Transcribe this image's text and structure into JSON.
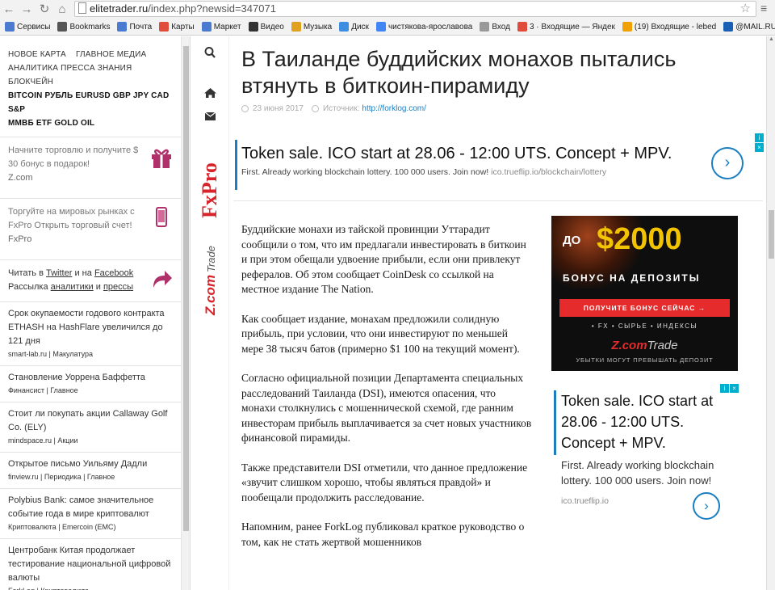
{
  "browser": {
    "url_host": "elitetrader.ru",
    "url_path": "/index.php?newsid=347071",
    "bookmarks": [
      {
        "label": "Сервисы",
        "color": "#4a7bd0"
      },
      {
        "label": "Bookmarks",
        "color": "#555555"
      },
      {
        "label": "Почта",
        "color": "#4a7bd0"
      },
      {
        "label": "Карты",
        "color": "#e14b3b"
      },
      {
        "label": "Маркет",
        "color": "#4a7bd0"
      },
      {
        "label": "Видео",
        "color": "#333333"
      },
      {
        "label": "Музыка",
        "color": "#e0a020"
      },
      {
        "label": "Диск",
        "color": "#3b8ee0"
      },
      {
        "label": "чистякова-ярославова",
        "color": "#4285f4"
      },
      {
        "label": "Вход",
        "color": "#999999"
      },
      {
        "label": "3 · Входящие — Яндек",
        "color": "#e14b3b"
      },
      {
        "label": "(19) Входящие - lebed",
        "color": "#f0a000"
      },
      {
        "label": "@MAIL.RU: почта, пои",
        "color": "#1a5fb4"
      }
    ]
  },
  "sidebar": {
    "categories_line1": [
      "НОВОЕ КАРТА",
      "ГЛАВНОЕ МЕДИА"
    ],
    "categories_line2": [
      "АНАЛИТИКА ПРЕССА ЗНАНИЯ БЛОКЧЕЙН"
    ],
    "categories_line3": [
      "BITCOIN РУБЛЬ EURUSD GBP JPY CAD S&P"
    ],
    "categories_line4": [
      "ММВБ ETF GOLD OIL"
    ],
    "promo1": {
      "text": "Начните торговлю и получите $ 30 бонус в подарок!",
      "source": "Z.com"
    },
    "promo2": {
      "text": "Торгуйте на мировых рынках с FxPro Открыть торговый счет!",
      "source": "FxPro"
    },
    "promo3": {
      "read_in": "Читать в",
      "twitter": "Twitter",
      "and": "и на",
      "facebook": "Facebook",
      "mailing": "Рассылка",
      "analytics": "аналитики",
      "and2": "и",
      "press": "прессы"
    },
    "news": [
      {
        "title": "Срок окупаемости годового контракта ETHASH на HashFlare увеличился до 121 дня",
        "source": "smart-lab.ru | Макулатура"
      },
      {
        "title": "Становление Уоррена Баффетта",
        "source": "Финансист | Главное"
      },
      {
        "title": "Стоит ли покупать акции Callaway Golf Co. (ELY)",
        "source": "mindspace.ru | Акции"
      },
      {
        "title": "Открытое письмо Уильяму Дадли",
        "source": "finview.ru | Периодика | Главное"
      },
      {
        "title": "Polybius Bank: самое значительное событие года в мире криптовалют",
        "source": "Криптовалюта | Emercoin (EMC)"
      },
      {
        "title": "Центробанк Китая продолжает тестирование национальной цифровой валюты",
        "source": "ForkLog | Криптовалюта"
      }
    ]
  },
  "brand_banners": {
    "fxpro": "FxPro",
    "zcom": "Z.com",
    "zcom_trade": "Trade"
  },
  "article": {
    "title": "В Таиланде буддийских монахов пытались втянуть в биткоин-пирамиду",
    "date": "23 июня 2017",
    "source_label": "Источник:",
    "source_url": "http://forklog.com/",
    "paragraphs": [
      "Буддийские монахи из тайской провинции Уттарадит сообщили о том, что им предлагали инвестировать в биткоин и при этом обещали удвоение прибыли, если они привлекут рефералов. Об этом сообщает CoinDesk со ссылкой на местное издание The Nation.",
      "Как сообщает издание, монахам предложили солидную прибыль, при условии, что они инвестируют по меньшей мере 38 тысяч батов (примерно $1 100 на текущий момент).",
      "Согласно официальной позиции Департамента специальных расследований Таиланда (DSI), имеются опасения, что монахи столкнулись с мошеннической схемой, где ранним инвесторам прибыль выплачивается за счет новых участников финансовой пирамиды.",
      "Также представители DSI отметили, что данное предложение «звучит слишком хорошо, чтобы являться правдой» и пообещали продолжить расследование.",
      "Напомним, ранее ForkLog публиковал краткое руководство о том, как не стать жертвой мошенников"
    ]
  },
  "ad_top": {
    "headline": "Token sale. ICO start at 28.06 - 12:00 UTS. Concept + MPV.",
    "sub": "First. Already working blockchain lottery. 100 000 users. Join now!",
    "url": "ico.trueflip.io/blockchain/lottery"
  },
  "ad_zcom": {
    "do": "ДО",
    "amount": "$2000",
    "bonus": "БОНУС НА ДЕПОЗИТЫ",
    "button": "ПОЛУЧИТЕ БОНУС СЕЙЧАС →",
    "features": "• FX • СЫРЬЕ • ИНДЕКСЫ",
    "logo": "Z.com",
    "logo_trade": "Trade",
    "warning": "УБЫТКИ МОГУТ ПРЕВЫШАТЬ ДЕПОЗИТ"
  },
  "ad_side": {
    "headline": "Token sale. ICO start at 28.06 - 12:00 UTS. Concept + MPV.",
    "sub": "First. Already working blockchain lottery. 100 000 users. Join now!",
    "url": "ico.trueflip.io"
  }
}
